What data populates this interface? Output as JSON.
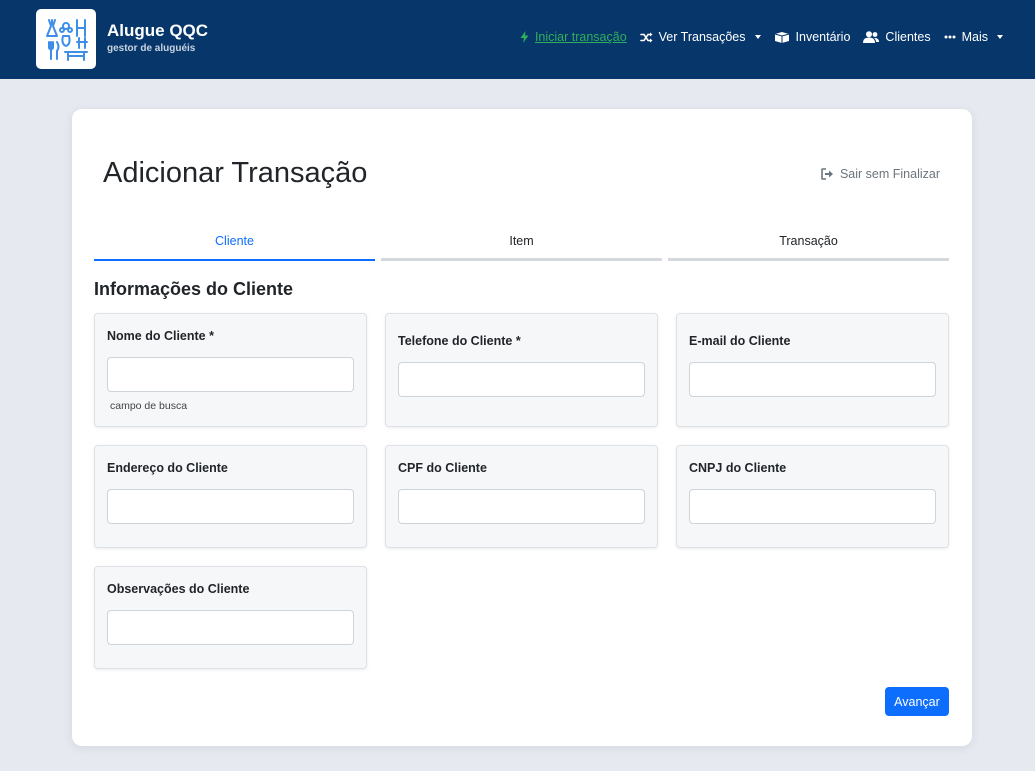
{
  "app": {
    "title": "Alugue QQC",
    "subtitle": "gestor de aluguéis"
  },
  "nav": {
    "items": [
      {
        "label": "Iniciar transação",
        "icon": "bolt-icon",
        "active": true
      },
      {
        "label": "Ver Transações",
        "icon": "shuffle-icon",
        "dropdown": true
      },
      {
        "label": "Inventário",
        "icon": "boxes-icon"
      },
      {
        "label": "Clientes",
        "icon": "users-icon"
      },
      {
        "label": "Mais",
        "icon": "ellipsis-icon",
        "dropdown": true
      }
    ]
  },
  "page": {
    "title": "Adicionar Transação",
    "exit_label": "Sair sem Finalizar"
  },
  "tabs": [
    {
      "label": "Cliente",
      "active": true
    },
    {
      "label": "Item"
    },
    {
      "label": "Transação"
    }
  ],
  "section_title": "Informações do Cliente",
  "fields": [
    {
      "label": "Nome do Cliente *",
      "value": "",
      "help": "campo de busca"
    },
    {
      "label": "Telefone do Cliente *",
      "value": ""
    },
    {
      "label": "E-mail do Cliente",
      "value": ""
    },
    {
      "label": "Endereço do Cliente",
      "value": ""
    },
    {
      "label": "CPF do Cliente",
      "value": ""
    },
    {
      "label": "CNPJ do Cliente",
      "value": ""
    },
    {
      "label": "Observações do Cliente",
      "value": ""
    }
  ],
  "actions": {
    "next_label": "Avançar"
  },
  "colors": {
    "navbar": "#07366b",
    "active_nav": "#2fae5c",
    "primary": "#0d6efd"
  }
}
